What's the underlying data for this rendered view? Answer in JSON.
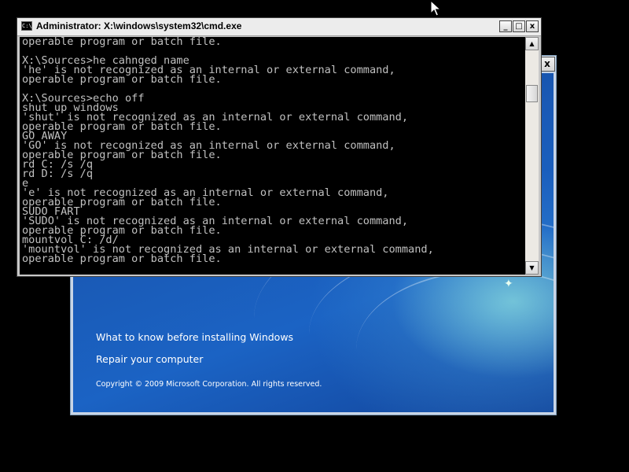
{
  "setup": {
    "close_label": "x",
    "links": [
      {
        "label": "What to know before installing Windows"
      },
      {
        "label": "Repair your computer"
      }
    ],
    "copyright": "Copyright © 2009 Microsoft Corporation. All rights reserved."
  },
  "cmd": {
    "title": "Administrator: X:\\windows\\system32\\cmd.exe",
    "icon_text": "C:\\",
    "buttons": {
      "minimize": "_",
      "maximize": "□",
      "close": "x"
    },
    "scroll_up": "▲",
    "scroll_down": "▼",
    "lines": [
      "operable program or batch file.",
      "",
      "X:\\Sources>he cahnged name",
      "'he' is not recognized as an internal or external command,",
      "operable program or batch file.",
      "",
      "X:\\Sources>echo off",
      "shut up windows",
      "'shut' is not recognized as an internal or external command,",
      "operable program or batch file.",
      "GO AWAY",
      "'GO' is not recognized as an internal or external command,",
      "operable program or batch file.",
      "rd C: /s /q",
      "rd D: /s /q",
      "e",
      "'e' is not recognized as an internal or external command,",
      "operable program or batch file.",
      "SUDO FART",
      "'SUDO' is not recognized as an internal or external command,",
      "operable program or batch file.",
      "mountvol C: /d/",
      "'mountvol' is not recognized as an internal or external command,",
      "operable program or batch file."
    ]
  },
  "colors": {
    "console_text": "#c0c0c0",
    "console_bg": "#000000",
    "setup_bg": "#1a5ab6"
  }
}
